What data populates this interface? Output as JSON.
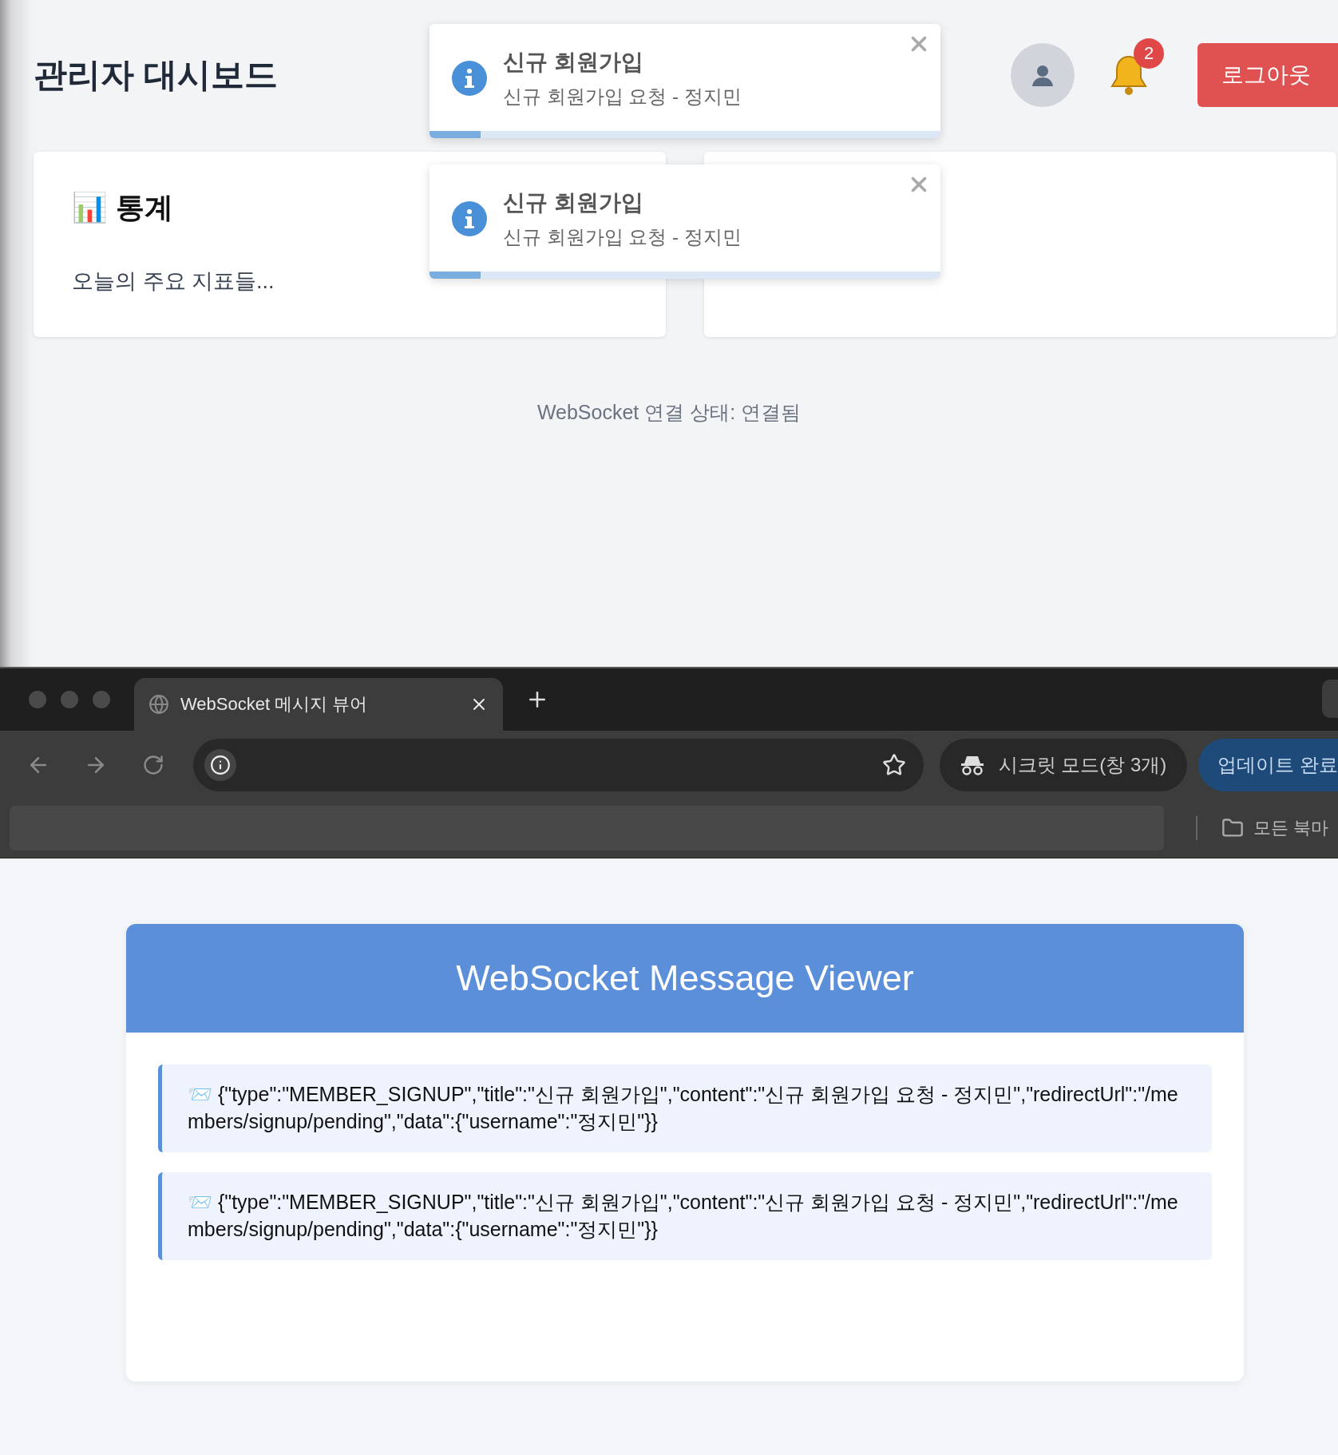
{
  "dashboard": {
    "title": "관리자 대시보드",
    "notification_count": "2",
    "logout_button": "로그아웃",
    "cards": [
      {
        "title": "📊 통계",
        "text": "오늘의 주요 지표들..."
      }
    ],
    "status": "WebSocket 연결 상태: 연결됨"
  },
  "toasts": [
    {
      "title": "신규 회원가입",
      "message": "신규 회원가입 요청 - 정지민",
      "level": 0.1
    },
    {
      "title": "신규 회원가입",
      "message": "신규 회원가입 요청 - 정지민",
      "level": 0.1
    }
  ],
  "browser": {
    "tabs": [
      {
        "title": "WebSocket 메시지 뷰어",
        "selected": true
      }
    ],
    "incognito": "시크릿 모드(창 3개)",
    "update_button": "업데이트 완료",
    "bookmarks_folder": "모든 북마"
  },
  "viewer": {
    "title": "WebSocket Message Viewer",
    "messages": [
      "📨 {\"type\":\"MEMBER_SIGNUP\",\"title\":\"신규 회원가입\",\"content\":\"신규 회원가입 요청 - 정지민\",\"redirectUrl\":\"/members/signup/pending\",\"data\":{\"username\":\"정지민\"}}",
      "📨 {\"type\":\"MEMBER_SIGNUP\",\"title\":\"신규 회원가입\",\"content\":\"신규 회원가입 요청 - 정지민\",\"redirectUrl\":\"/members/signup/pending\",\"data\":{\"username\":\"정지민\"}}"
    ]
  }
}
